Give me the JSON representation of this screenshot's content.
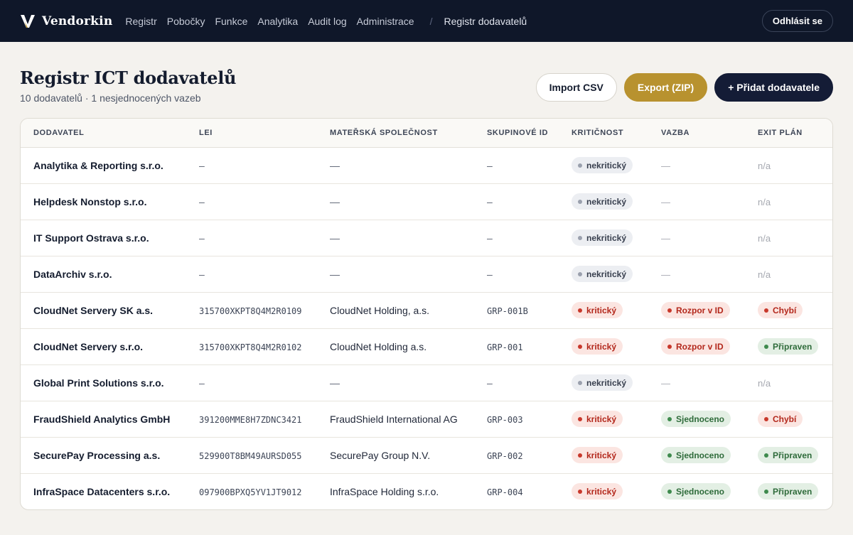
{
  "nav": {
    "brand": "Vendorkin",
    "items": [
      "Registr",
      "Pobočky",
      "Funkce",
      "Analytika",
      "Audit log",
      "Administrace"
    ],
    "separator": "/",
    "current": "Registr dodavatelů",
    "logout_label": "Odhlásit se"
  },
  "header": {
    "title": "Registr ICT dodavatelů",
    "subtitle": "10 dodavatelů · 1 nesjednocených vazeb",
    "import_label": "Import CSV",
    "export_label": "Export (ZIP)",
    "add_label": "+ Přidat dodavatele"
  },
  "colors": {
    "nav_bg": "#0f1729",
    "page_bg": "#f4f2ee",
    "gold": "#b8922f",
    "dark_button": "#141c36",
    "critical": "#b3271b",
    "ok": "#2e6b3a"
  },
  "table": {
    "columns": [
      "Dodavatel",
      "LEI",
      "Mateřská společnost",
      "Skupinové ID",
      "Kritičnost",
      "Vazba",
      "Exit plán"
    ],
    "rows": [
      {
        "vendor": "Analytika & Reporting s.r.o.",
        "lei": "–",
        "parent": "—",
        "group": "–",
        "criticality": "nekritický",
        "crit_type": "neutral",
        "link": "—",
        "link_type": "none",
        "exit": "n/a",
        "exit_type": "none"
      },
      {
        "vendor": "Helpdesk Nonstop s.r.o.",
        "lei": "–",
        "parent": "—",
        "group": "–",
        "criticality": "nekritický",
        "crit_type": "neutral",
        "link": "—",
        "link_type": "none",
        "exit": "n/a",
        "exit_type": "none"
      },
      {
        "vendor": "IT Support Ostrava s.r.o.",
        "lei": "–",
        "parent": "—",
        "group": "–",
        "criticality": "nekritický",
        "crit_type": "neutral",
        "link": "—",
        "link_type": "none",
        "exit": "n/a",
        "exit_type": "none"
      },
      {
        "vendor": "DataArchiv s.r.o.",
        "lei": "–",
        "parent": "—",
        "group": "–",
        "criticality": "nekritický",
        "crit_type": "neutral",
        "link": "—",
        "link_type": "none",
        "exit": "n/a",
        "exit_type": "none"
      },
      {
        "vendor": "CloudNet Servery SK a.s.",
        "lei": "315700XKPT8Q4M2R0109",
        "parent": "CloudNet Holding, a.s.",
        "group": "GRP-001B",
        "criticality": "kritický",
        "crit_type": "red",
        "link": "Rozpor v ID",
        "link_type": "red",
        "exit": "Chybí",
        "exit_type": "red"
      },
      {
        "vendor": "CloudNet Servery s.r.o.",
        "lei": "315700XKPT8Q4M2R0102",
        "parent": "CloudNet Holding a.s.",
        "group": "GRP-001",
        "criticality": "kritický",
        "crit_type": "red",
        "link": "Rozpor v ID",
        "link_type": "red",
        "exit": "Připraven",
        "exit_type": "green"
      },
      {
        "vendor": "Global Print Solutions s.r.o.",
        "lei": "–",
        "parent": "—",
        "group": "–",
        "criticality": "nekritický",
        "crit_type": "neutral",
        "link": "—",
        "link_type": "none",
        "exit": "n/a",
        "exit_type": "none"
      },
      {
        "vendor": "FraudShield Analytics GmbH",
        "lei": "391200MME8H7ZDNC3421",
        "parent": "FraudShield International AG",
        "group": "GRP-003",
        "criticality": "kritický",
        "crit_type": "red",
        "link": "Sjednoceno",
        "link_type": "green",
        "exit": "Chybí",
        "exit_type": "red"
      },
      {
        "vendor": "SecurePay Processing a.s.",
        "lei": "529900T8BM49AURSD055",
        "parent": "SecurePay Group N.V.",
        "group": "GRP-002",
        "criticality": "kritický",
        "crit_type": "red",
        "link": "Sjednoceno",
        "link_type": "green",
        "exit": "Připraven",
        "exit_type": "green"
      },
      {
        "vendor": "InfraSpace Datacenters s.r.o.",
        "lei": "097900BPXQ5YV1JT9012",
        "parent": "InfraSpace Holding s.r.o.",
        "group": "GRP-004",
        "criticality": "kritický",
        "crit_type": "red",
        "link": "Sjednoceno",
        "link_type": "green",
        "exit": "Připraven",
        "exit_type": "green"
      }
    ]
  }
}
